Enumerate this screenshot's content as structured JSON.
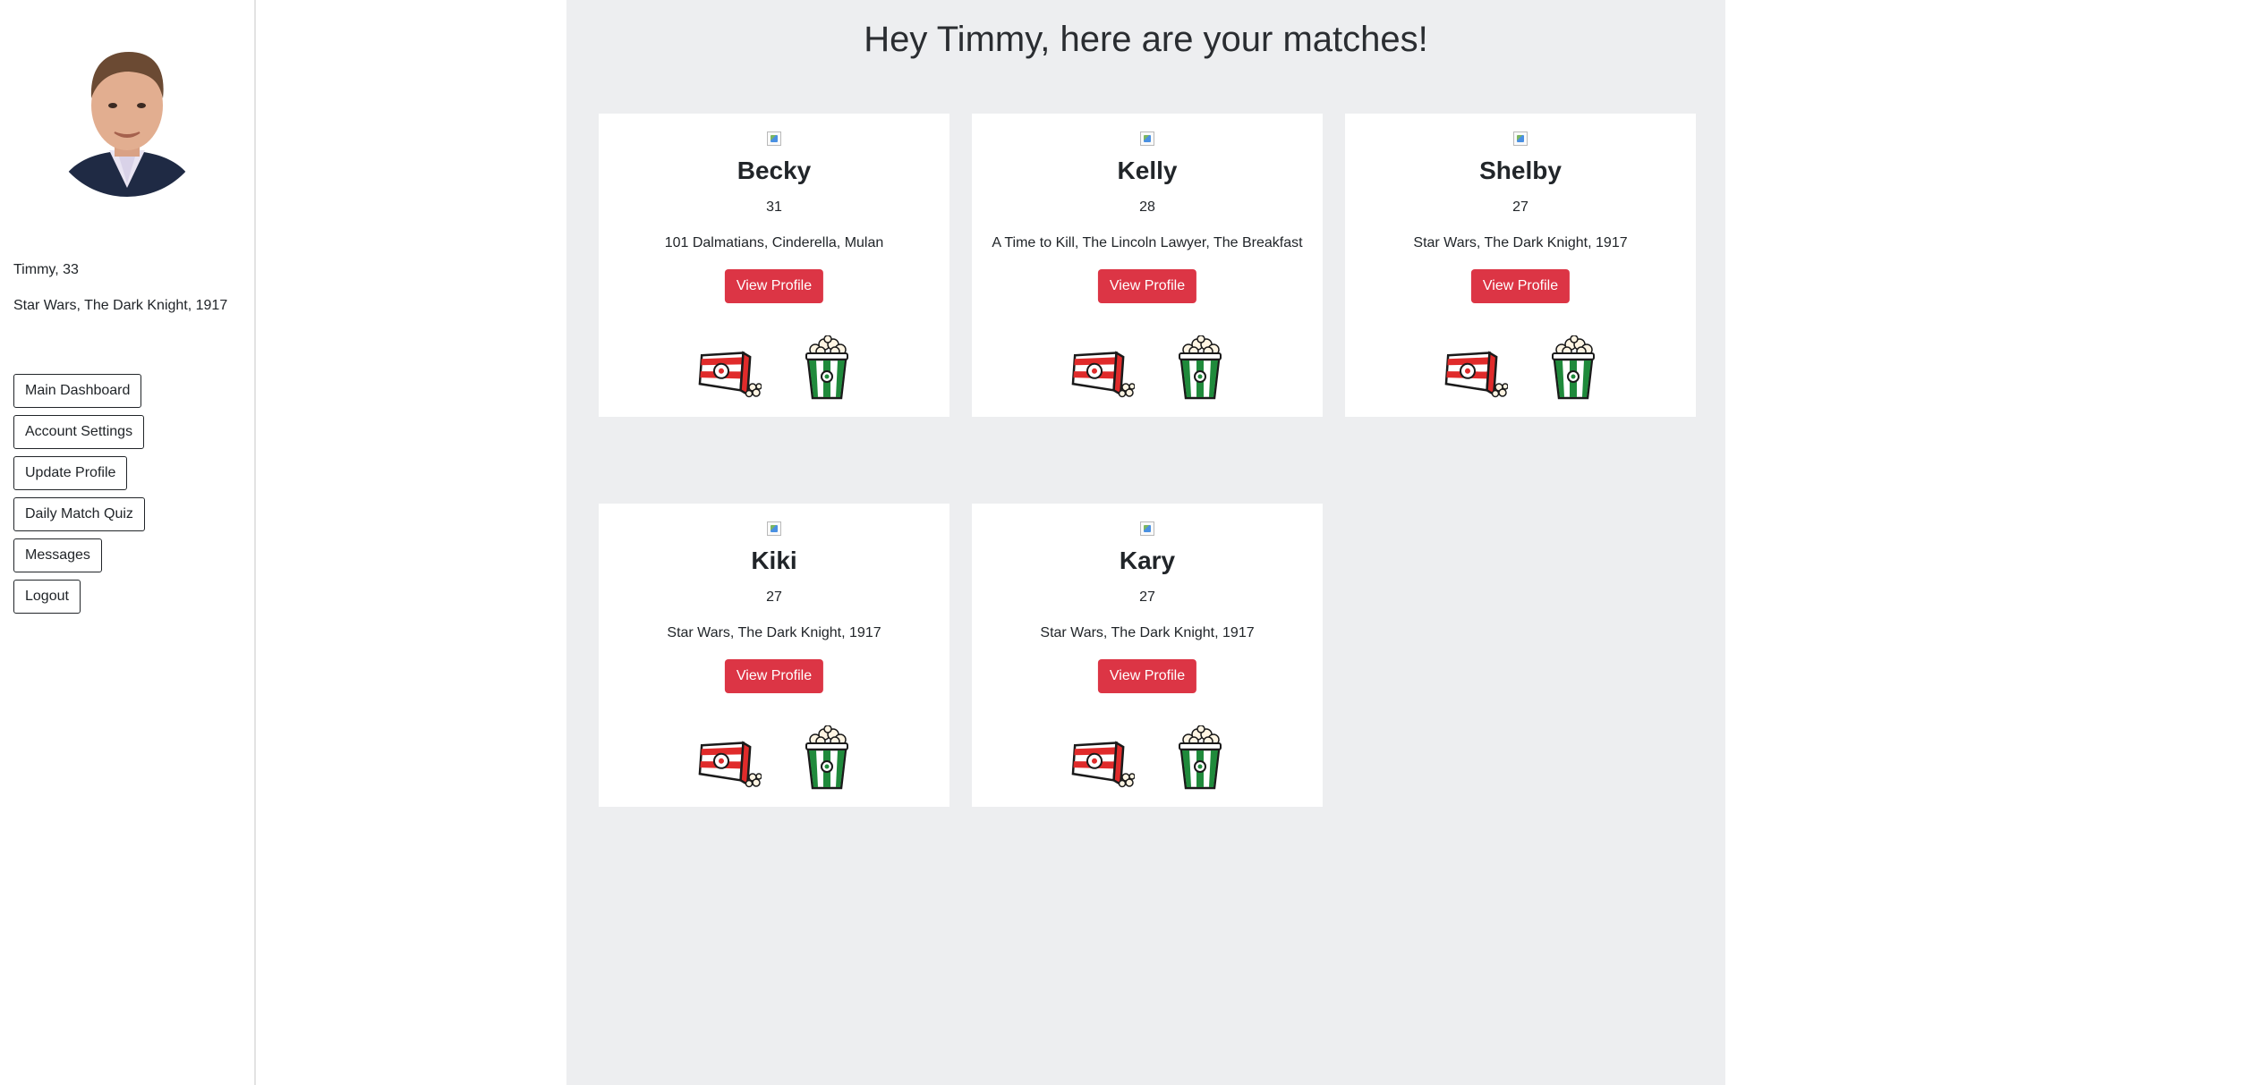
{
  "sidebar": {
    "user_line": "Timmy, 33",
    "movies_line": "Star Wars, The Dark Knight, 1917",
    "nav": [
      {
        "label": "Main Dashboard"
      },
      {
        "label": "Account Settings"
      },
      {
        "label": "Update Profile"
      },
      {
        "label": "Daily Match Quiz"
      },
      {
        "label": "Messages"
      },
      {
        "label": "Logout"
      }
    ]
  },
  "main": {
    "heading": "Hey Timmy, here are your matches!",
    "view_label": "View Profile",
    "matches": [
      {
        "name": "Becky",
        "age": "31",
        "movies": "101 Dalmatians, Cinderella, Mulan"
      },
      {
        "name": "Kelly",
        "age": "28",
        "movies": "A Time to Kill, The Lincoln Lawyer, The Breakfast"
      },
      {
        "name": "Shelby",
        "age": "27",
        "movies": "Star Wars, The Dark Knight, 1917"
      },
      {
        "name": "Kiki",
        "age": "27",
        "movies": "Star Wars, The Dark Knight, 1917"
      },
      {
        "name": "Kary",
        "age": "27",
        "movies": "Star Wars, The Dark Knight, 1917"
      }
    ]
  },
  "icons": {
    "dislike": "spilled-popcorn-icon",
    "like": "popcorn-bucket-icon"
  },
  "colors": {
    "accent": "#dc3545",
    "main_bg": "#edeef0",
    "dislike_red": "#e02b2b",
    "like_green": "#1f8a3b"
  }
}
